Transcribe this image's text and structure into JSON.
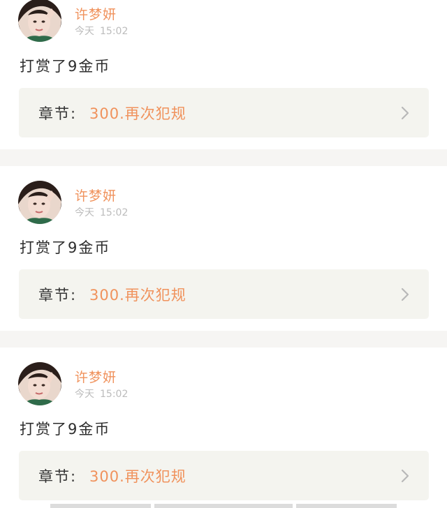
{
  "feed": {
    "entries": [
      {
        "user_name": "许梦妍",
        "day": "今天",
        "time": "15:02",
        "message": "打赏了9金币",
        "chapter_label": "章节:",
        "chapter_title": "300.再次犯规"
      },
      {
        "user_name": "许梦妍",
        "day": "今天",
        "time": "15:02",
        "message": "打赏了9金币",
        "chapter_label": "章节:",
        "chapter_title": "300.再次犯规"
      },
      {
        "user_name": "许梦妍",
        "day": "今天",
        "time": "15:02",
        "message": "打赏了9金币",
        "chapter_label": "章节:",
        "chapter_title": "300.再次犯规"
      }
    ]
  },
  "icons": {
    "chapter_arrow": "chevron-right-icon"
  },
  "colors": {
    "accent": "#f0925c",
    "timestamp": "#bcbcbc",
    "message": "#2c2c2c",
    "chapter_box": "#f4f4ef",
    "separator": "#f6f5f3"
  }
}
